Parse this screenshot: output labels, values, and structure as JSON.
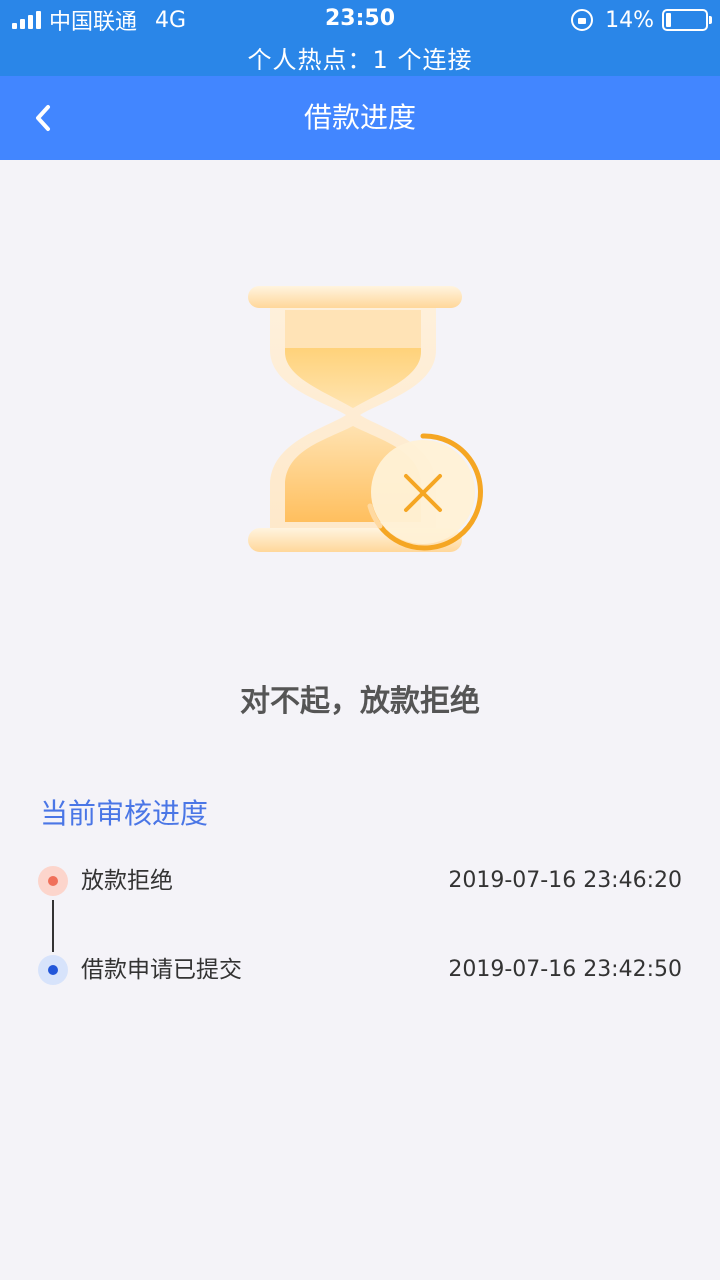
{
  "status_bar": {
    "carrier": "中国联通",
    "network": "4G",
    "time": "23:50",
    "battery": "14%",
    "battery_level": 0.14,
    "hotspot": "个人热点：1 个连接"
  },
  "nav": {
    "title": "借款进度"
  },
  "result": {
    "message": "对不起，放款拒绝"
  },
  "progress": {
    "section_title": "当前审核进度",
    "steps": [
      {
        "label": "放款拒绝",
        "time": "2019-07-16 23:46:20",
        "color": "#f0705a"
      },
      {
        "label": "借款申请已提交",
        "time": "2019-07-16 23:42:50",
        "color": "#2256d9"
      }
    ]
  },
  "colors": {
    "status_bar": "#2a86e8",
    "nav_bar": "#4286ff",
    "accent_blue": "#4a76e6",
    "hourglass": "#ffc766",
    "reject_ring": "#f5a623"
  }
}
